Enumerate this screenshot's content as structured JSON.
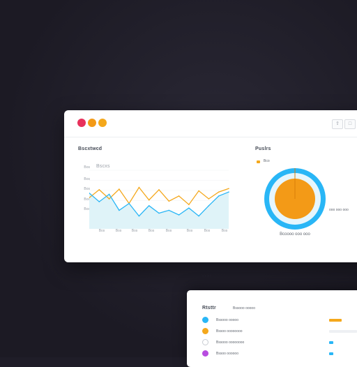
{
  "window": {
    "controls": [
      "close",
      "minimize",
      "maximize"
    ],
    "actions": [
      {
        "icon": "share-icon"
      },
      {
        "icon": "expand-icon"
      }
    ],
    "chart_panel": {
      "title": "Bscxtwcd",
      "sub_title": "Bscxs"
    },
    "donut_panel": {
      "title": "Puslrs",
      "legend_label": "Bco",
      "caption": "Bcoooo ooo ooo",
      "side_label": "ooo ooo ooo"
    }
  },
  "card2": {
    "title": "Rtsttr",
    "sub_title": "Bssooo ooooo",
    "rows": [
      {
        "icon": "info-icon",
        "label": "Bssooo ooooo",
        "color": "#29b6f6"
      },
      {
        "icon": "alert-icon",
        "label": "Bssoo oooooooo",
        "color": "#f4a81c"
      },
      {
        "icon": "user-icon",
        "label": "Bssooo oooooooo",
        "color": "#9aa0a8"
      },
      {
        "icon": "tag-icon",
        "label": "Bssoo oooooo",
        "color": "#b84ce0"
      }
    ]
  },
  "chart_data": {
    "type": "line",
    "x": [
      "Bos",
      "Bos",
      "Bos",
      "Bos",
      "Bos",
      "Bos",
      "Bos",
      "Bos"
    ],
    "y_ticks": [
      "Bos",
      "Bos",
      "Bos",
      "Bos",
      "Bos"
    ],
    "series": [
      {
        "color": "#f4a81c",
        "values": [
          52,
          66,
          50,
          67,
          42,
          70,
          48,
          66,
          46,
          55,
          40,
          64,
          50,
          62,
          68
        ]
      },
      {
        "color": "#29b6f6",
        "values": [
          60,
          45,
          58,
          30,
          42,
          20,
          38,
          25,
          30,
          22,
          34,
          20,
          38,
          55,
          62
        ],
        "fill": "#dff3f8"
      }
    ],
    "donut": {
      "type": "pie",
      "values": [
        100
      ],
      "colors": [
        "#f39a17",
        "#29b6f6"
      ]
    }
  }
}
